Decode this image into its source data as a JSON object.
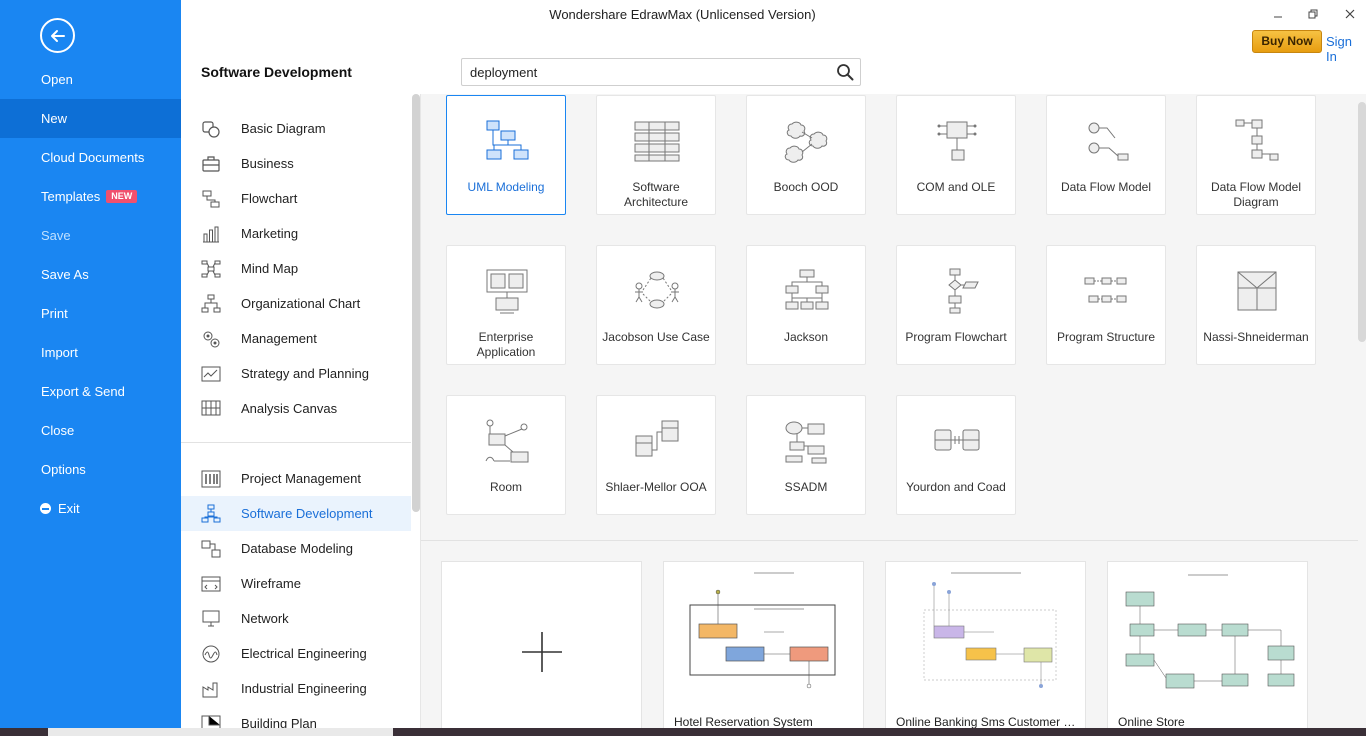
{
  "window": {
    "title": "Wondershare EdrawMax (Unlicensed Version)",
    "buy_now": "Buy Now",
    "sign_in": "Sign In"
  },
  "left_menu": {
    "items": [
      {
        "label": "Open"
      },
      {
        "label": "New"
      },
      {
        "label": "Cloud Documents"
      },
      {
        "label": "Templates",
        "badge": "NEW"
      },
      {
        "label": "Save"
      },
      {
        "label": "Save As"
      },
      {
        "label": "Print"
      },
      {
        "label": "Import"
      },
      {
        "label": "Export & Send"
      },
      {
        "label": "Close"
      },
      {
        "label": "Options"
      },
      {
        "label": "Exit"
      }
    ],
    "active_index": 1,
    "accent": "#1a86f2"
  },
  "header": {
    "section_title": "Software Development",
    "search_value": "deployment"
  },
  "categories": {
    "group1": [
      {
        "label": "Basic Diagram",
        "icon": "shapes-icon"
      },
      {
        "label": "Business",
        "icon": "briefcase-icon"
      },
      {
        "label": "Flowchart",
        "icon": "flowchart-icon"
      },
      {
        "label": "Marketing",
        "icon": "bar-chart-icon"
      },
      {
        "label": "Mind Map",
        "icon": "mind-map-icon"
      },
      {
        "label": "Organizational Chart",
        "icon": "org-chart-icon"
      },
      {
        "label": "Management",
        "icon": "gears-icon"
      },
      {
        "label": "Strategy and Planning",
        "icon": "line-chart-icon"
      },
      {
        "label": "Analysis Canvas",
        "icon": "canvas-icon"
      }
    ],
    "group2": [
      {
        "label": "Project Management",
        "icon": "gantt-icon"
      },
      {
        "label": "Software Development",
        "icon": "software-icon"
      },
      {
        "label": "Database Modeling",
        "icon": "database-icon"
      },
      {
        "label": "Wireframe",
        "icon": "wireframe-icon"
      },
      {
        "label": "Network",
        "icon": "network-icon"
      },
      {
        "label": "Electrical Engineering",
        "icon": "electrical-icon"
      },
      {
        "label": "Industrial Engineering",
        "icon": "industrial-icon"
      },
      {
        "label": "Building Plan",
        "icon": "building-icon"
      }
    ]
  },
  "types": [
    {
      "label": "UML Modeling"
    },
    {
      "label": "Software Architecture"
    },
    {
      "label": "Booch OOD"
    },
    {
      "label": "COM and OLE"
    },
    {
      "label": "Data Flow Model"
    },
    {
      "label": "Data Flow Model Diagram"
    },
    {
      "label": "Enterprise Application"
    },
    {
      "label": "Jacobson Use Case"
    },
    {
      "label": "Jackson"
    },
    {
      "label": "Program Flowchart"
    },
    {
      "label": "Program Structure"
    },
    {
      "label": "Nassi-Shneiderman"
    },
    {
      "label": "Room"
    },
    {
      "label": "Shlaer-Mellor OOA"
    },
    {
      "label": "SSADM"
    },
    {
      "label": "Yourdon and Coad"
    }
  ],
  "templates": [
    {
      "caption": ""
    },
    {
      "caption": "Hotel Reservation System"
    },
    {
      "caption": "Online Banking Sms Customer S..."
    },
    {
      "caption": "Online Store"
    }
  ]
}
